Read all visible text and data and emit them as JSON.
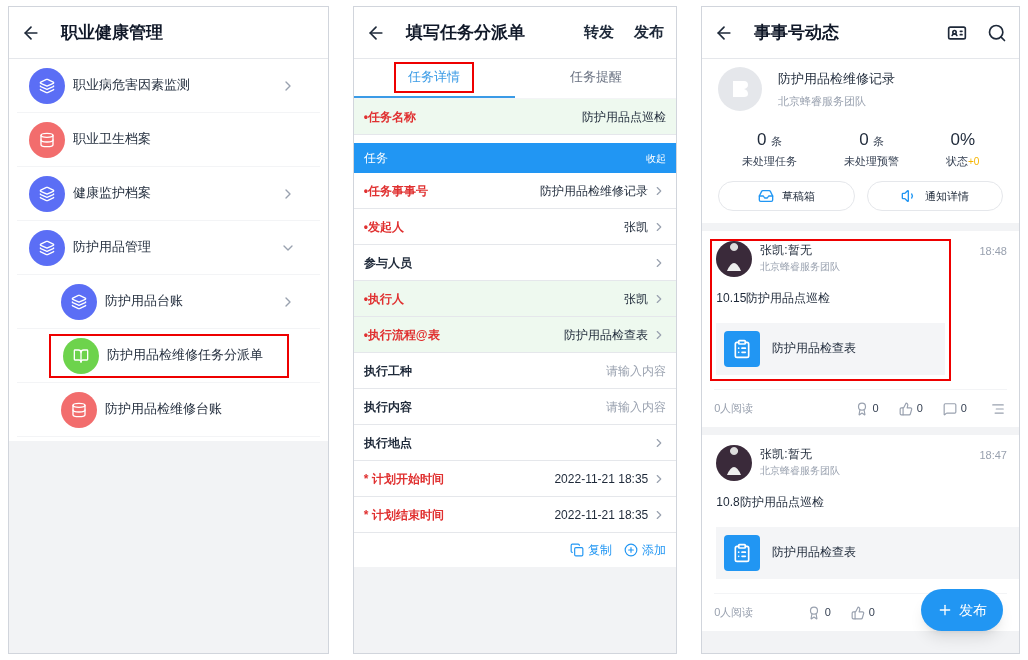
{
  "screens": [
    {
      "header": {
        "title": "职业健康管理"
      },
      "menu": [
        {
          "label": "职业病危害因素监测",
          "kind": "stack",
          "color": "#5b6ef5",
          "chevron": true,
          "highlighted": false
        },
        {
          "label": "职业卫生档案",
          "kind": "database",
          "color": "#f26d6d",
          "chevron": false,
          "highlighted": false
        },
        {
          "label": "健康监护档案",
          "kind": "stack",
          "color": "#5b6ef5",
          "chevron": true,
          "highlighted": false
        },
        {
          "label": "防护用品管理",
          "kind": "stack",
          "color": "#5b6ef5",
          "chevron": true,
          "highlighted": false,
          "children": [
            {
              "label": "防护用品台账",
              "kind": "stack",
              "color": "#5b6ef5",
              "chevron": true,
              "highlighted": false
            },
            {
              "label": "防护用品检维修任务分派单",
              "kind": "book",
              "color": "#6dd34c",
              "chevron": false,
              "highlighted": true
            },
            {
              "label": "防护用品检维修台账",
              "kind": "database",
              "color": "#f26d6d",
              "chevron": false,
              "highlighted": false
            }
          ]
        }
      ]
    },
    {
      "header": {
        "title": "填写任务分派单",
        "actions": [
          "转发",
          "发布"
        ]
      },
      "tabs": [
        {
          "label": "任务详情",
          "selected": true,
          "highlighted": true
        },
        {
          "label": "任务提醒",
          "selected": false,
          "highlighted": false
        }
      ],
      "rows": [
        {
          "kind": "field",
          "label": "•任务名称",
          "value": "防护用品点巡检",
          "required": true,
          "highlighted": true,
          "arrow": false
        },
        {
          "kind": "section",
          "label": "任务",
          "action": "收起"
        },
        {
          "kind": "field",
          "label": "•任务事事号",
          "value": "防护用品检维修记录",
          "required": true,
          "highlighted": false,
          "arrow": true
        },
        {
          "kind": "field",
          "label": "•发起人",
          "value": "张凯",
          "required": true,
          "highlighted": false,
          "arrow": true
        },
        {
          "kind": "field",
          "label": "参与人员",
          "required": false,
          "highlighted": false,
          "arrow": true
        },
        {
          "kind": "field",
          "label": "•执行人",
          "value": "张凯",
          "required": true,
          "highlighted": true,
          "arrow": true
        },
        {
          "kind": "field",
          "label": "•执行流程@表",
          "value": "防护用品检查表",
          "required": true,
          "highlighted": true,
          "arrow": true
        },
        {
          "kind": "field",
          "label": "执行工种",
          "placeholder": "请输入内容",
          "required": false,
          "highlighted": false,
          "arrow": false
        },
        {
          "kind": "field",
          "label": "执行内容",
          "placeholder": "请输入内容",
          "required": false,
          "highlighted": false,
          "arrow": false
        },
        {
          "kind": "field",
          "label": "执行地点",
          "required": false,
          "highlighted": false,
          "arrow": true
        },
        {
          "kind": "field",
          "label": "* 计划开始时间",
          "value": "2022-11-21 18:35",
          "required": true,
          "highlighted": false,
          "arrow": true
        },
        {
          "kind": "field",
          "label": "* 计划结束时间",
          "value": "2022-11-21 18:35",
          "required": true,
          "highlighted": false,
          "arrow": true
        }
      ],
      "footer_actions": [
        {
          "label": "复制"
        },
        {
          "label": "添加"
        }
      ]
    },
    {
      "header": {
        "title": "事事号动态"
      },
      "profile": {
        "name": "防护用品检维修记录",
        "team": "北京蜂睿服务团队"
      },
      "stats": [
        {
          "value": "0",
          "unit": "条",
          "label": "未处理任务"
        },
        {
          "value": "0",
          "unit": "条",
          "label": "未处理预警"
        },
        {
          "value": "0%",
          "label": "状态",
          "delta": "+0"
        }
      ],
      "buttons": [
        {
          "label": "草稿箱"
        },
        {
          "label": "通知详情"
        }
      ],
      "posts": [
        {
          "author": "张凯:暂无",
          "team": "北京蜂睿服务团队",
          "time": "18:48",
          "text": "10.15防护用品点巡检",
          "attachment": "防护用品检查表",
          "reads": "0人阅读",
          "counts": [
            "0",
            "0",
            "0"
          ],
          "highlighted": true
        },
        {
          "author": "张凯:暂无",
          "team": "北京蜂睿服务团队",
          "time": "18:47",
          "text": "10.8防护用品点巡检",
          "attachment": "防护用品检查表",
          "reads": "0人阅读",
          "counts": [
            "0",
            "0"
          ],
          "highlighted": false
        }
      ],
      "fab": {
        "label": "发布"
      }
    }
  ]
}
